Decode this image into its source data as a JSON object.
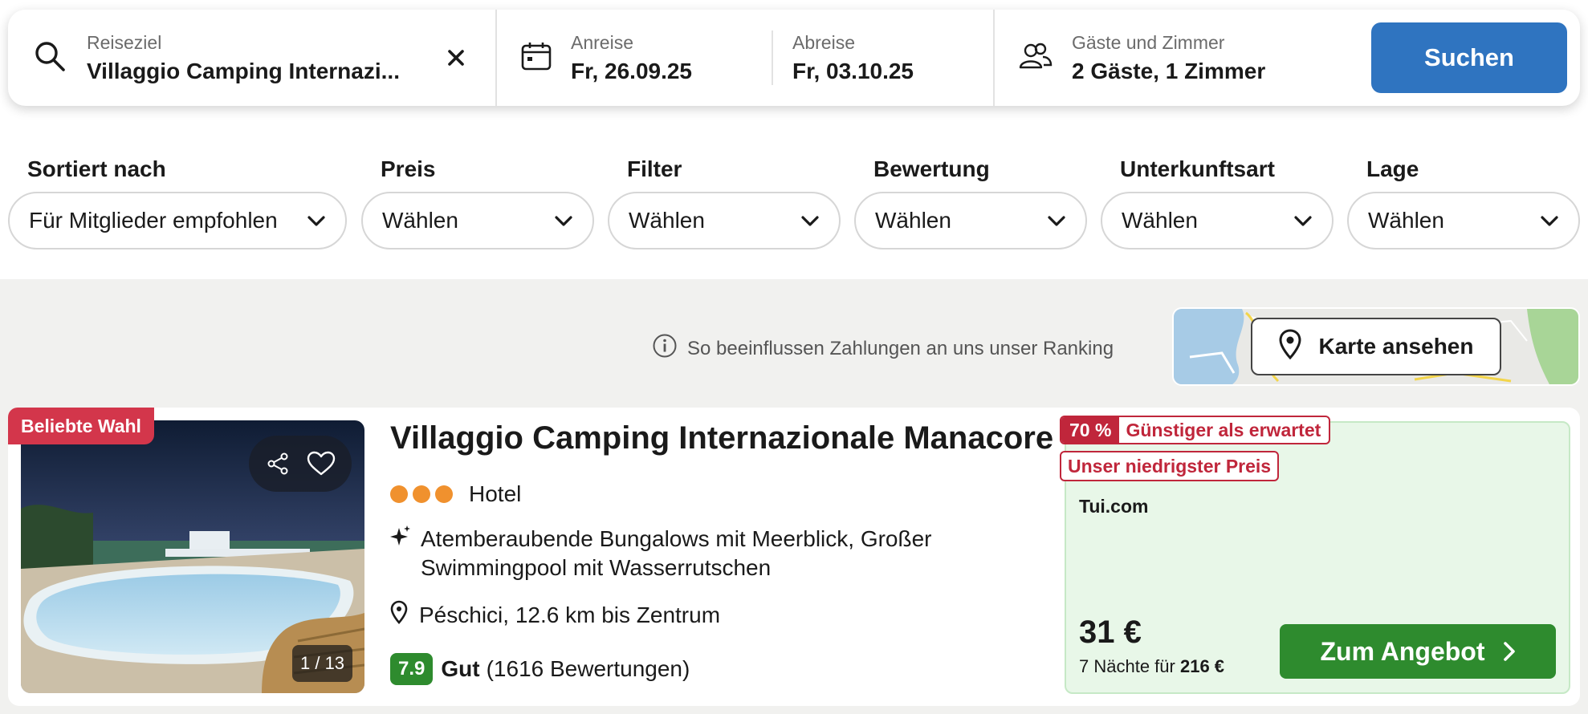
{
  "search": {
    "destination_label": "Reiseziel",
    "destination_value": "Villaggio Camping Internazi...",
    "checkin_label": "Anreise",
    "checkin_value": "Fr, 26.09.25",
    "checkout_label": "Abreise",
    "checkout_value": "Fr, 03.10.25",
    "guests_label": "Gäste und Zimmer",
    "guests_value": "2 Gäste, 1 Zimmer",
    "search_button": "Suchen"
  },
  "filters": [
    {
      "label": "Sortiert nach",
      "value": "Für Mitglieder empfohlen"
    },
    {
      "label": "Preis",
      "value": "Wählen"
    },
    {
      "label": "Filter",
      "value": "Wählen"
    },
    {
      "label": "Bewertung",
      "value": "Wählen"
    },
    {
      "label": "Unterkunftsart",
      "value": "Wählen"
    },
    {
      "label": "Lage",
      "value": "Wählen"
    }
  ],
  "ranking_note": "So beeinflussen Zahlungen an uns unser Ranking",
  "map_button": "Karte ansehen",
  "result": {
    "badge": "Beliebte Wahl",
    "photo_counter": "1 / 13",
    "name": "Villaggio Camping Internazionale Manacore",
    "stars": 3,
    "type": "Hotel",
    "highlight": "Atemberaubende Bungalows mit Meerblick, Großer Swimmingpool mit Wasserrutschen",
    "location": "Péschici, 12.6 km bis Zentrum",
    "score": "7.9",
    "rating_word": "Gut",
    "rating_count": "(1616 Bewertungen)",
    "deal_percent": "70 %",
    "deal_text": "Günstiger als erwartet",
    "lowest_price_text": "Unser niedrigster Preis",
    "provider": "Tui.com",
    "price": "31 €",
    "nights_text": "7 Nächte für",
    "total_price": "216 €",
    "offer_button": "Zum Angebot"
  },
  "colors": {
    "search_button": "#2f74c0",
    "popular_badge": "#d3364b",
    "deal_red": "#c0263b",
    "score_green": "#2e8b2e",
    "offer_green": "#2e8b2e",
    "deal_bg": "#e8f7e8",
    "stars": "#f0912e"
  }
}
